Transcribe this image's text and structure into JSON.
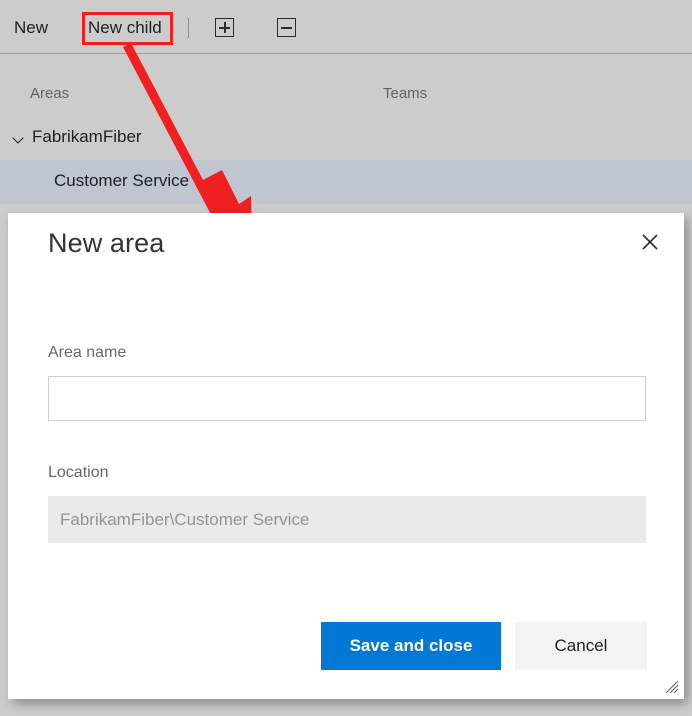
{
  "toolbar": {
    "new_label": "New",
    "new_child_label": "New child",
    "expand_icon": "plus-square-icon",
    "collapse_icon": "minus-square-icon"
  },
  "annotation": {
    "highlight_target": "New child",
    "color": "#f02020"
  },
  "grid": {
    "columns": [
      "Areas",
      "Teams"
    ],
    "rows": [
      {
        "label": "FabrikamFiber",
        "level": 0,
        "expanded": true,
        "selected": false
      },
      {
        "label": "Customer Service",
        "level": 1,
        "expanded": false,
        "selected": true
      }
    ],
    "selected_row_color": "#bfc6d0"
  },
  "dialog": {
    "title": "New area",
    "close_icon": "close-icon",
    "fields": {
      "area_name": {
        "label": "Area name",
        "value": "",
        "placeholder": ""
      },
      "location": {
        "label": "Location",
        "value": "FabrikamFiber\\Customer Service",
        "readonly": true
      }
    },
    "buttons": {
      "save_label": "Save and close",
      "save_color": "#0078d4",
      "cancel_label": "Cancel"
    },
    "resize_grip_icon": "resize-grip-icon"
  }
}
